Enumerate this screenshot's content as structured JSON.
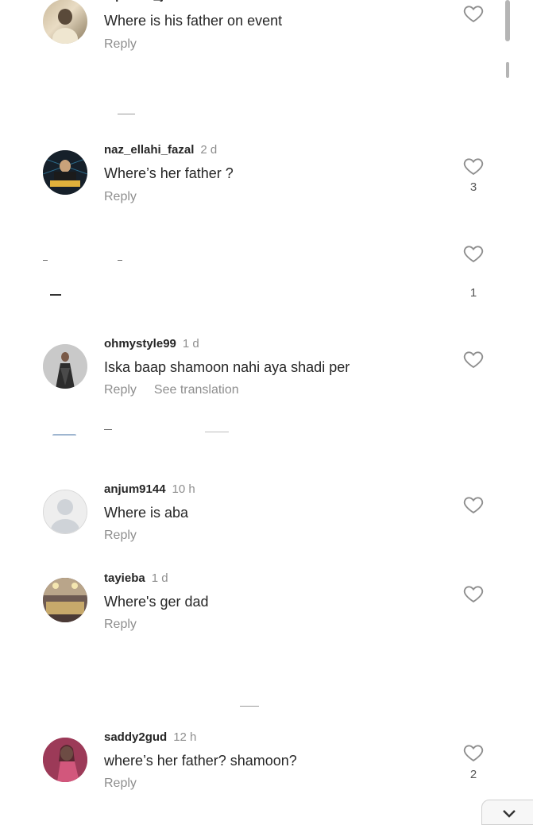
{
  "comments": [
    {
      "username": "repeated_jokes",
      "time": "",
      "text": "Where is his father on event",
      "reply": "Reply",
      "likes": ""
    },
    {
      "username": "naz_ellahi_fazal",
      "time": "2 d",
      "text": "Where’s her father ?",
      "reply": "Reply",
      "likes": "3"
    },
    {
      "username": "",
      "time": "",
      "text": "",
      "reply": "",
      "likes": "1"
    },
    {
      "username": "ohmystyle99",
      "time": "1 d",
      "text": "Iska baap shamoon nahi aya shadi per",
      "reply": "Reply",
      "translate": "See translation",
      "likes": ""
    },
    {
      "username": "anjum9144",
      "time": "10 h",
      "text": "Where is aba",
      "reply": "Reply",
      "likes": ""
    },
    {
      "username": "tayieba",
      "time": "1 d",
      "text": "Where's ger dad",
      "reply": "Reply",
      "likes": ""
    },
    {
      "username": "saddy2gud",
      "time": "12 h",
      "text": "where’s her father? shamoon?",
      "reply": "Reply",
      "likes": "2"
    }
  ],
  "colors": {
    "text": "#262626",
    "muted": "#8e8e8e",
    "background": "#ffffff"
  },
  "icons": {
    "like": "heart-outline-icon",
    "avatar_placeholder": "default-avatar-icon"
  }
}
